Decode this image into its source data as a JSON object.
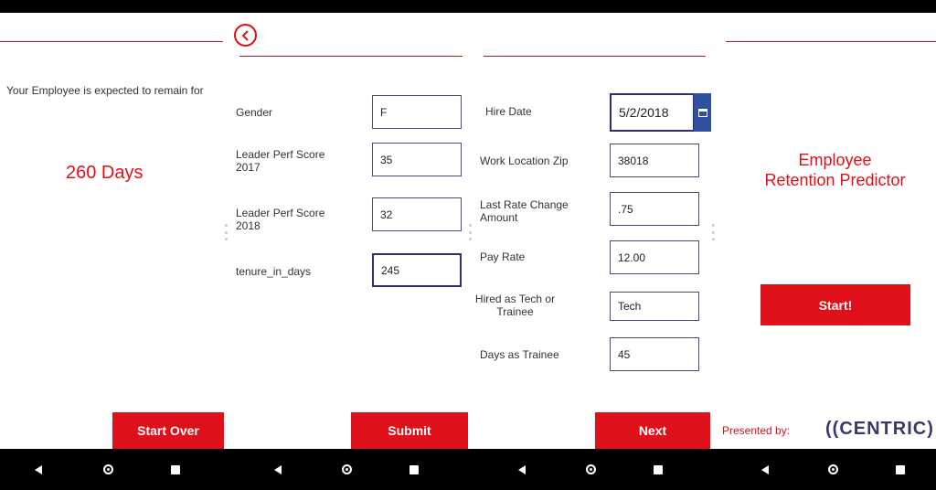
{
  "panel1": {
    "expectation_text": "Your Employee is expected to remain for",
    "days_result": "260 Days",
    "start_over_label": "Start Over"
  },
  "panel2": {
    "fields": [
      {
        "label": "Gender",
        "value": "F"
      },
      {
        "label": "Leader Perf Score 2017",
        "value": "35"
      },
      {
        "label": "Leader Perf Score 2018",
        "value": "32"
      },
      {
        "label": "tenure_in_days",
        "value": "245"
      }
    ],
    "submit_label": "Submit",
    "back_icon": "chevron-left-circle-icon"
  },
  "panel3": {
    "fields": [
      {
        "label": "Hire Date",
        "value": "5/2/2018"
      },
      {
        "label": "Work Location Zip",
        "value": "38018"
      },
      {
        "label": "Last Rate Change Amount",
        "value": ".75"
      },
      {
        "label": "Pay Rate",
        "value": "12.00"
      },
      {
        "label": "Hired as Tech or Trainee",
        "value": "Tech"
      },
      {
        "label": "Days as Trainee",
        "value": "45"
      }
    ],
    "next_label": "Next",
    "calendar_icon": "calendar-icon"
  },
  "panel4": {
    "title_line1": "Employee",
    "title_line2": "Retention Predictor",
    "start_label": "Start!",
    "presented_by": "Presented by:",
    "logo_text": "((CENTRIC)"
  },
  "colors": {
    "accent": "#e0101a",
    "input_border": "#4a4a7a",
    "calendar": "#2f4f9f",
    "logo_paren": "#e0a800",
    "logo_text": "#3a3a6a"
  }
}
